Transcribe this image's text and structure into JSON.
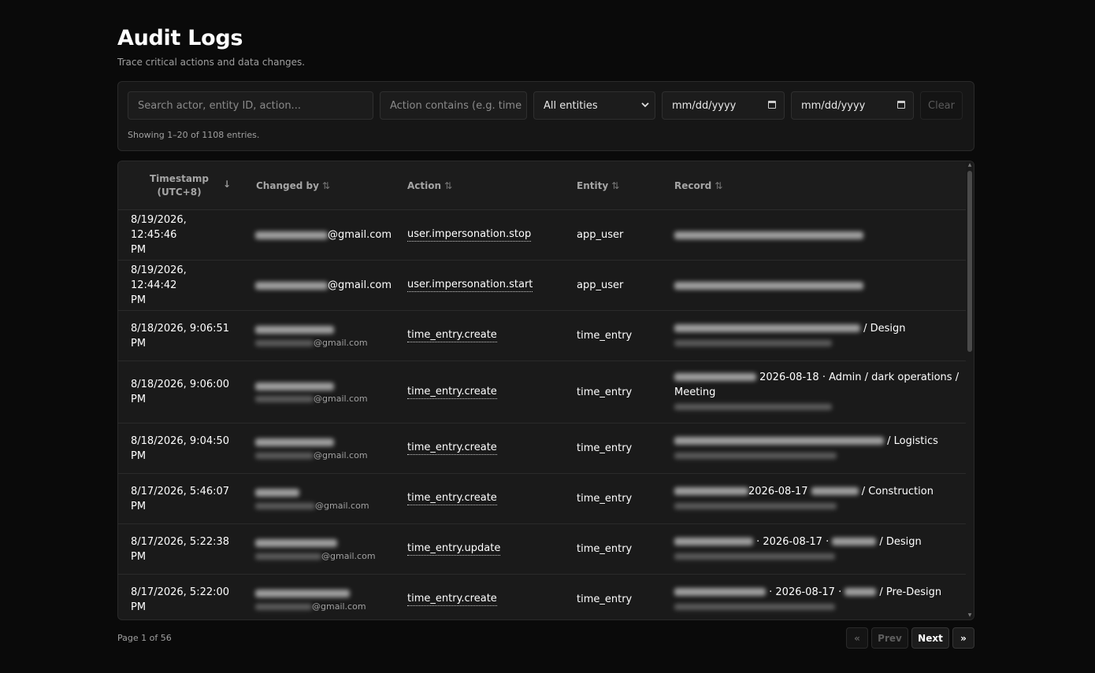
{
  "page": {
    "title": "Audit Logs",
    "subtitle": "Trace critical actions and data changes."
  },
  "filters": {
    "search_placeholder": "Search actor, entity ID, action...",
    "action_placeholder": "Action contains (e.g. time",
    "entity_select": "All entities",
    "date_from": "mm/dd/yyyy",
    "date_to": "mm/dd/yyyy",
    "clear_label": "Clear",
    "showing": "Showing 1–20 of 1108 entries."
  },
  "table": {
    "headers": {
      "timestamp_line1": "Timestamp",
      "timestamp_line2": "(UTC+8)",
      "changed_by": "Changed by",
      "action": "Action",
      "entity": "Entity",
      "record": "Record"
    },
    "rows": [
      {
        "ts1": "8/19/2026, 12:45:46",
        "ts2": "PM",
        "actor_suffix": "@gmail.com",
        "action": "user.impersonation.stop",
        "entity": "app_user",
        "record_text": ""
      },
      {
        "ts1": "8/19/2026, 12:44:42",
        "ts2": "PM",
        "actor_suffix": "@gmail.com",
        "action": "user.impersonation.start",
        "entity": "app_user",
        "record_text": ""
      },
      {
        "ts1": "8/18/2026, 9:06:51",
        "ts2": "PM",
        "actor_suffix": "@gmail.com",
        "action": "time_entry.create",
        "entity": "time_entry",
        "record_text": " / Design"
      },
      {
        "ts1": "8/18/2026, 9:06:00",
        "ts2": "PM",
        "actor_suffix": "@gmail.com",
        "action": "time_entry.create",
        "entity": "time_entry",
        "record_text": " 2026-08-18 · Admin / dark operations /",
        "record_text2": "Meeting"
      },
      {
        "ts1": "8/18/2026, 9:04:50",
        "ts2": "PM",
        "actor_suffix": "@gmail.com",
        "action": "time_entry.create",
        "entity": "time_entry",
        "record_text": " / Logistics"
      },
      {
        "ts1": "8/17/2026, 5:46:07",
        "ts2": "PM",
        "actor_suffix": "@gmail.com",
        "action": "time_entry.create",
        "entity": "time_entry",
        "record_text": "2026-08-17",
        "record_text_b": " / Construction"
      },
      {
        "ts1": "8/17/2026, 5:22:38",
        "ts2": "PM",
        "actor_suffix": "@gmail.com",
        "action": "time_entry.update",
        "entity": "time_entry",
        "record_text": " · 2026-08-17 ·",
        "record_text_b": " / Design"
      },
      {
        "ts1": "8/17/2026, 5:22:00",
        "ts2": "PM",
        "actor_suffix": "@gmail.com",
        "action": "time_entry.create",
        "entity": "time_entry",
        "record_text": " · 2026-08-17 ·",
        "record_text_b": " / Pre-Design"
      }
    ]
  },
  "pagination": {
    "page_info": "Page 1 of 56",
    "first": "«",
    "prev": "Prev",
    "next": "Next",
    "last": "»"
  }
}
